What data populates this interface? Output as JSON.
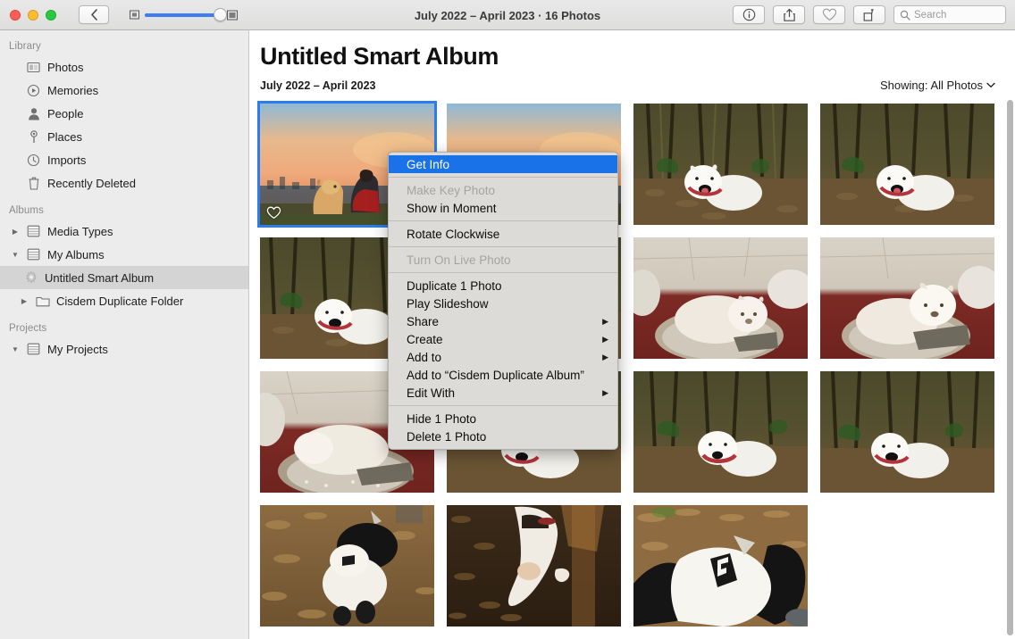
{
  "window": {
    "title": "July 2022 – April 2023 · 16 Photos",
    "traffic": {
      "close": "close-button",
      "minimize": "minimize-button",
      "zoom": "zoom-button"
    }
  },
  "toolbar": {
    "back_label": "‹",
    "zoom_slider": {
      "min_icon": "small-thumbnail-icon",
      "max_icon": "large-thumbnail-icon",
      "value": 86
    },
    "info_label": "ⓘ",
    "share_label": "share-icon",
    "favorite_label": "heart-icon",
    "rotate_label": "rotate-icon",
    "search_placeholder": "Search"
  },
  "sidebar": {
    "sections": [
      {
        "header": "Library",
        "items": [
          {
            "label": "Photos",
            "icon": "photos-icon",
            "selected": false,
            "disclosure": "none"
          },
          {
            "label": "Memories",
            "icon": "memories-icon",
            "selected": false,
            "disclosure": "none"
          },
          {
            "label": "People",
            "icon": "people-icon",
            "selected": false,
            "disclosure": "none"
          },
          {
            "label": "Places",
            "icon": "places-pin-icon",
            "selected": false,
            "disclosure": "none"
          },
          {
            "label": "Imports",
            "icon": "imports-clock-icon",
            "selected": false,
            "disclosure": "none"
          },
          {
            "label": "Recently Deleted",
            "icon": "trash-icon",
            "selected": false,
            "disclosure": "none"
          }
        ]
      },
      {
        "header": "Albums",
        "items": [
          {
            "label": "Media Types",
            "icon": "album-stack-icon",
            "selected": false,
            "disclosure": "collapsed"
          },
          {
            "label": "My Albums",
            "icon": "album-stack-icon",
            "selected": false,
            "disclosure": "expanded"
          },
          {
            "label": "Untitled Smart Album",
            "icon": "gear-icon",
            "selected": true,
            "disclosure": "none",
            "indent": 2
          },
          {
            "label": "Cisdem Duplicate Folder",
            "icon": "folder-icon",
            "selected": false,
            "disclosure": "collapsed",
            "indent": 2
          }
        ]
      },
      {
        "header": "Projects",
        "items": [
          {
            "label": "My Projects",
            "icon": "album-stack-icon",
            "selected": false,
            "disclosure": "expanded"
          }
        ]
      }
    ]
  },
  "main": {
    "album_title": "Untitled Smart Album",
    "date_range": "July 2022 – April 2023",
    "showing_label": "Showing:",
    "showing_value": "All Photos",
    "showing_chevron": "chevron-down-icon",
    "photos": [
      {
        "name": "photo-sunset-dog-man",
        "selected": true,
        "favorite": true,
        "scene": "sunset-hill"
      },
      {
        "name": "photo-sunset-dog-man-2",
        "selected": false,
        "favorite": false,
        "scene": "sunset-hill"
      },
      {
        "name": "photo-samoyed-bamboo-1",
        "selected": false,
        "favorite": false,
        "scene": "bamboo-forest"
      },
      {
        "name": "photo-samoyed-bamboo-2",
        "selected": false,
        "favorite": false,
        "scene": "bamboo-forest"
      },
      {
        "name": "photo-samoyed-bamboo-3",
        "selected": false,
        "favorite": false,
        "scene": "bamboo-forest"
      },
      {
        "name": "photo-samoyed-bamboo-4",
        "selected": false,
        "favorite": false,
        "scene": "bamboo-forest"
      },
      {
        "name": "photo-dog-basket-1",
        "selected": false,
        "favorite": false,
        "scene": "dog-bed"
      },
      {
        "name": "photo-dog-basket-2",
        "selected": false,
        "favorite": false,
        "scene": "dog-bed"
      },
      {
        "name": "photo-dog-basket-3",
        "selected": false,
        "favorite": false,
        "scene": "dog-bed"
      },
      {
        "name": "photo-samoyed-bamboo-5",
        "selected": false,
        "favorite": false,
        "scene": "bamboo-forest"
      },
      {
        "name": "photo-samoyed-bamboo-6",
        "selected": false,
        "favorite": false,
        "scene": "bamboo-forest"
      },
      {
        "name": "photo-samoyed-bamboo-7",
        "selected": false,
        "favorite": false,
        "scene": "bamboo-forest"
      },
      {
        "name": "photo-samoyed-bamboo-8",
        "selected": false,
        "favorite": false,
        "scene": "bamboo-forest"
      },
      {
        "name": "photo-black-white-puppy",
        "selected": false,
        "favorite": false,
        "scene": "leaves-puppy"
      },
      {
        "name": "photo-dog-ground-1",
        "selected": false,
        "favorite": false,
        "scene": "leaves-dark"
      },
      {
        "name": "photo-dog-coat",
        "selected": false,
        "favorite": false,
        "scene": "leaves-coat"
      }
    ]
  },
  "context_menu": {
    "items": [
      {
        "label": "Get Info",
        "state": "highlight",
        "submenu": false
      },
      {
        "separator": true
      },
      {
        "label": "Make Key Photo",
        "state": "disabled",
        "submenu": false
      },
      {
        "label": "Show in Moment",
        "state": "normal",
        "submenu": false
      },
      {
        "separator": true
      },
      {
        "label": "Rotate Clockwise",
        "state": "normal",
        "submenu": false
      },
      {
        "separator": true
      },
      {
        "label": "Turn On Live Photo",
        "state": "disabled",
        "submenu": false
      },
      {
        "separator": true
      },
      {
        "label": "Duplicate 1 Photo",
        "state": "normal",
        "submenu": false
      },
      {
        "label": "Play Slideshow",
        "state": "normal",
        "submenu": false
      },
      {
        "label": "Share",
        "state": "normal",
        "submenu": true
      },
      {
        "label": "Create",
        "state": "normal",
        "submenu": true
      },
      {
        "label": "Add to",
        "state": "normal",
        "submenu": true
      },
      {
        "label": "Add to “Cisdem Duplicate Album”",
        "state": "normal",
        "submenu": false
      },
      {
        "label": "Edit With",
        "state": "normal",
        "submenu": true
      },
      {
        "separator": true
      },
      {
        "label": "Hide 1 Photo",
        "state": "normal",
        "submenu": false
      },
      {
        "label": "Delete 1 Photo",
        "state": "normal",
        "submenu": false
      }
    ],
    "submenu_arrow": "▶"
  }
}
